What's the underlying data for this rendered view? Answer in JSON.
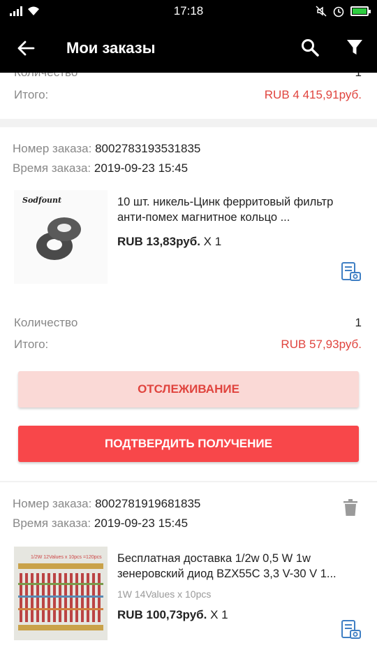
{
  "status_bar": {
    "time": "17:18"
  },
  "app_bar": {
    "title": "Мои заказы"
  },
  "prev_order": {
    "qty_label": "Количество",
    "qty_value": "1",
    "total_label": "Итого:",
    "total_value": "RUB 4 415,91руб."
  },
  "order1": {
    "number_label": "Номер заказа:",
    "number": "8002783193531835",
    "time_label": "Время заказа:",
    "time": "2019-09-23 15:45",
    "product_title": "10 шт. никель-Цинк ферритовый фильтр анти-помех магнитное кольцо ...",
    "image_brand": "Sodfount",
    "price": "RUB 13,83руб.",
    "qty_mult": "X 1",
    "qty_label": "Количество",
    "qty_value": "1",
    "total_label": "Итого:",
    "total_value": "RUB 57,93руб.",
    "track_button": "ОТСЛЕЖИВАНИЕ",
    "confirm_button": "ПОДТВЕРДИТЬ ПОЛУЧЕНИЕ"
  },
  "order2": {
    "number_label": "Номер заказа:",
    "number": "8002781919681835",
    "time_label": "Время заказа:",
    "time": "2019-09-23 15:45",
    "product_title": "Бесплатная доставка 1/2w 0,5 W 1w зенеровский диод BZX55C 3,3 V-30 V 1...",
    "variant": "1W 14Values x 10pcs",
    "price": "RUB 100,73руб.",
    "qty_mult": "X 1",
    "image_caption": "1/2W 12Values x 10pcs =120pcs"
  },
  "colors": {
    "accent_red": "#e0443e",
    "confirm_bg": "#f8474a",
    "track_bg": "#fad9d6",
    "icon_blue": "#3f7fc4"
  }
}
